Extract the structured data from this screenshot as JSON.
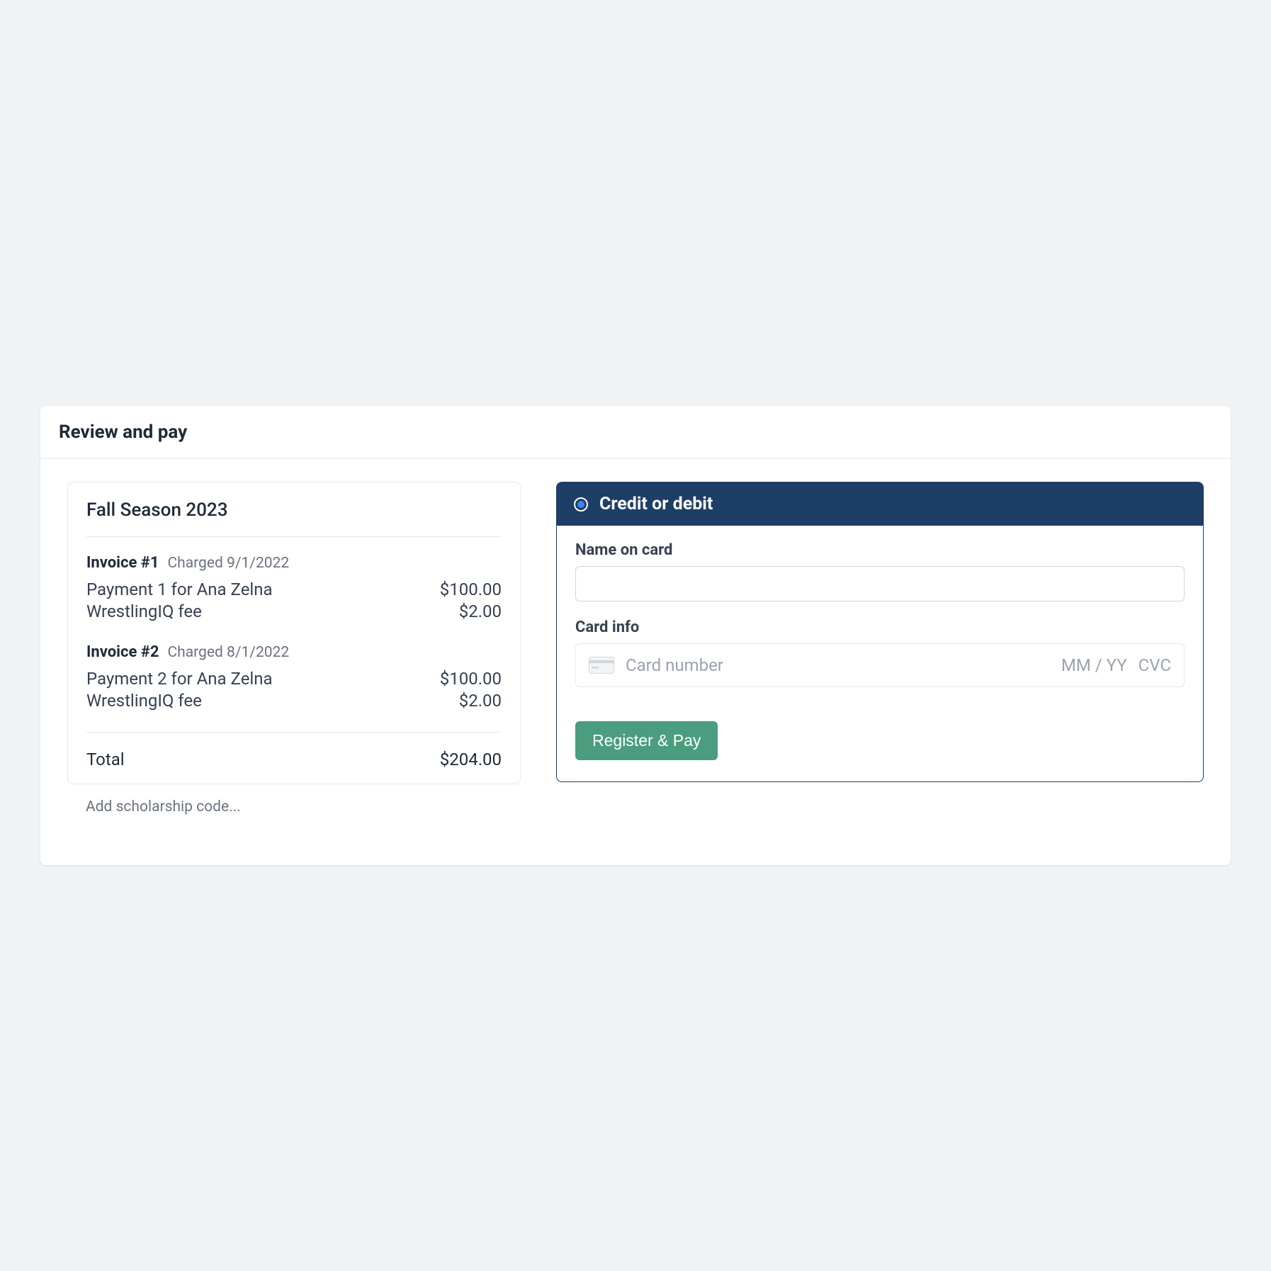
{
  "header": {
    "title": "Review and pay"
  },
  "summary": {
    "title": "Fall Season 2023",
    "invoices": [
      {
        "label": "Invoice #1",
        "charged": "Charged 9/1/2022",
        "lines": [
          {
            "desc": "Payment 1 for Ana Zelna",
            "amount": "$100.00"
          },
          {
            "desc": "WrestlingIQ fee",
            "amount": "$2.00"
          }
        ]
      },
      {
        "label": "Invoice #2",
        "charged": "Charged 8/1/2022",
        "lines": [
          {
            "desc": "Payment 2 for Ana Zelna",
            "amount": "$100.00"
          },
          {
            "desc": "WrestlingIQ fee",
            "amount": "$2.00"
          }
        ]
      }
    ],
    "total_label": "Total",
    "total_amount": "$204.00",
    "scholarship_link": "Add scholarship code..."
  },
  "payment": {
    "method_label": "Credit or debit",
    "name_label": "Name on card",
    "name_value": "",
    "card_info_label": "Card info",
    "card_number_placeholder": "Card number",
    "card_exp_placeholder": "MM / YY",
    "card_cvc_placeholder": "CVC",
    "submit_label": "Register & Pay"
  }
}
